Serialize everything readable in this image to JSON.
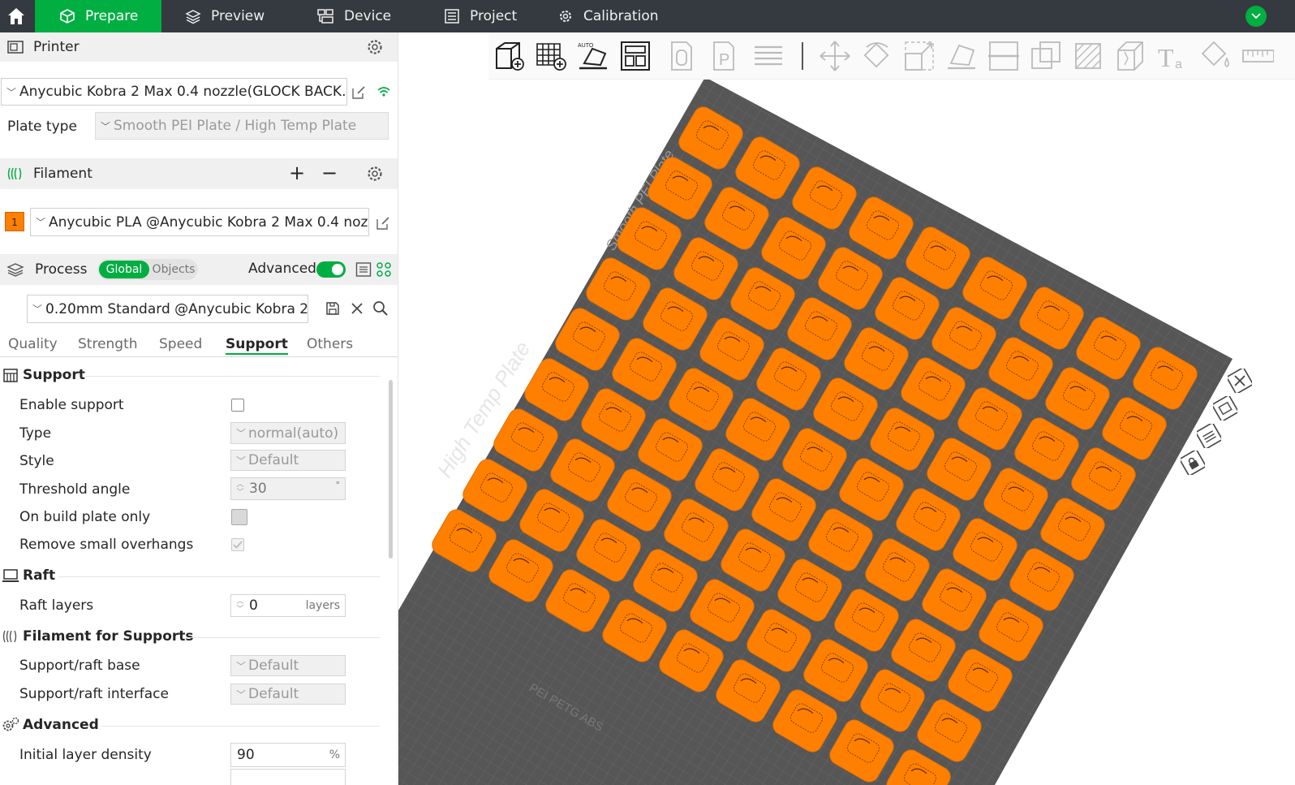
{
  "topbar": {
    "tabs": [
      {
        "label": "Prepare",
        "icon": "cube-icon",
        "active": true
      },
      {
        "label": "Preview",
        "icon": "layers-icon",
        "active": false
      },
      {
        "label": "Device",
        "icon": "device-icon",
        "active": false
      },
      {
        "label": "Project",
        "icon": "document-icon",
        "active": false
      },
      {
        "label": "Calibration",
        "icon": "calibration-gear-icon",
        "active": false
      }
    ],
    "accent_color": "#00ae42"
  },
  "printer": {
    "header": "Printer",
    "name": "Anycubic Kobra 2 Max 0.4 nozzle(GLOCK BACK...",
    "plate_type_label": "Plate type",
    "plate_type_value": "Smooth PEI Plate / High Temp Plate"
  },
  "filament": {
    "header": "Filament",
    "add": "+",
    "remove": "−",
    "slot_number": "1",
    "slot_color": "#ff7f00",
    "name": "Anycubic PLA @Anycubic Kobra 2 Max 0.4 nozzle..."
  },
  "process": {
    "header": "Process",
    "global_label": "Global",
    "objects_label": "Objects",
    "advanced_label": "Advanced",
    "advanced_on": true,
    "preset": "0.20mm Standard @Anycubic Kobra 2..."
  },
  "tabs": {
    "quality": "Quality",
    "strength": "Strength",
    "speed": "Speed",
    "support": "Support",
    "others": "Others",
    "active": "Support"
  },
  "support": {
    "group": "Support",
    "enable_label": "Enable support",
    "enable_value": false,
    "type_label": "Type",
    "type_value": "normal(auto)",
    "style_label": "Style",
    "style_value": "Default",
    "threshold_label": "Threshold angle",
    "threshold_value": "30",
    "threshold_unit": "°",
    "build_plate_only_label": "On build plate only",
    "remove_overhangs_label": "Remove small overhangs",
    "remove_overhangs_value": true
  },
  "raft": {
    "group": "Raft",
    "layers_label": "Raft layers",
    "layers_value": "0",
    "layers_unit": "layers"
  },
  "filament_supports": {
    "group": "Filament for Supports",
    "base_label": "Support/raft base",
    "base_value": "Default",
    "interface_label": "Support/raft interface",
    "interface_value": "Default"
  },
  "advanced": {
    "group": "Advanced",
    "density_label": "Initial layer density",
    "density_value": "90",
    "density_unit": "%"
  },
  "scene": {
    "plate_text": "High Temp Plate",
    "plate_text_bottom": "PEI PETG ABS",
    "plate_text_top": "Smooth PEI Plate",
    "part_color": "#ff8000",
    "plate_color": "#565656",
    "part_rows": 9,
    "part_cols": 9
  }
}
